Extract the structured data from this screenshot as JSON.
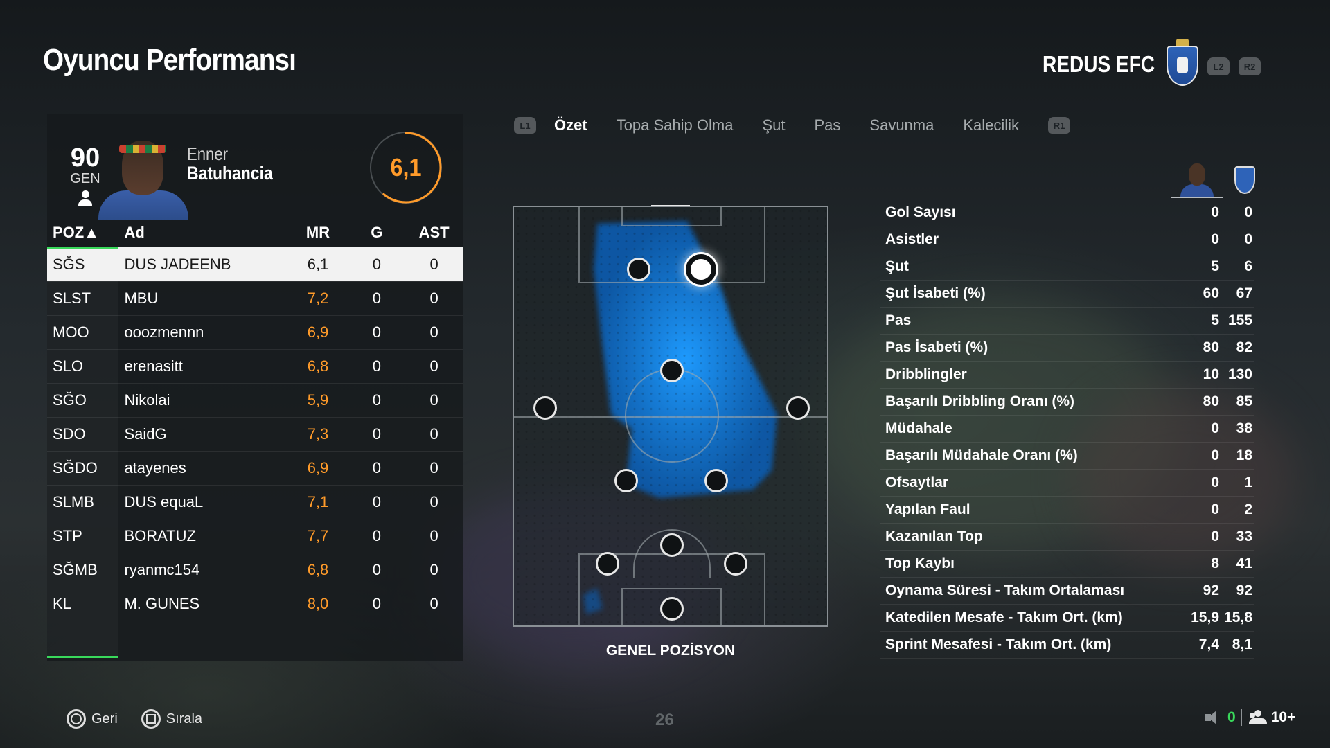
{
  "header": {
    "title": "Oyuncu Performansı",
    "club_name": "REDUS EFC",
    "l2_label": "L2",
    "r2_label": "R2"
  },
  "player": {
    "overall": "90",
    "overall_label": "GEN",
    "first_name": "Enner",
    "last_name": "Batuhancia",
    "match_rating": "6,1",
    "rating_fraction": 0.61
  },
  "table": {
    "headers": {
      "pos": "POZ▲",
      "name": "Ad",
      "mr": "MR",
      "g": "G",
      "ast": "AST"
    },
    "rows": [
      {
        "pos": "SĞS",
        "name": "DUS JADEENB",
        "mr": "6,1",
        "g": "0",
        "ast": "0",
        "selected": true
      },
      {
        "pos": "SLST",
        "name": "MBU",
        "mr": "7,2",
        "g": "0",
        "ast": "0"
      },
      {
        "pos": "MOO",
        "name": "ooozmennn",
        "mr": "6,9",
        "g": "0",
        "ast": "0"
      },
      {
        "pos": "SLO",
        "name": "erenasitt",
        "mr": "6,8",
        "g": "0",
        "ast": "0"
      },
      {
        "pos": "SĞO",
        "name": "Nikolai",
        "mr": "5,9",
        "g": "0",
        "ast": "0"
      },
      {
        "pos": "SDO",
        "name": "SaidG",
        "mr": "7,3",
        "g": "0",
        "ast": "0"
      },
      {
        "pos": "SĞDO",
        "name": "atayenes",
        "mr": "6,9",
        "g": "0",
        "ast": "0"
      },
      {
        "pos": "SLMB",
        "name": "DUS equaL",
        "mr": "7,1",
        "g": "0",
        "ast": "0"
      },
      {
        "pos": "STP",
        "name": "BORATUZ",
        "mr": "7,7",
        "g": "0",
        "ast": "0"
      },
      {
        "pos": "SĞMB",
        "name": "ryanmc154",
        "mr": "6,8",
        "g": "0",
        "ast": "0"
      },
      {
        "pos": "KL",
        "name": "M. GUNES",
        "mr": "8,0",
        "g": "0",
        "ast": "0"
      }
    ]
  },
  "tabs": {
    "l1": "L1",
    "r1": "R1",
    "items": [
      "Özet",
      "Topa Sahip Olma",
      "Şut",
      "Pas",
      "Savunma",
      "Kalecilik"
    ],
    "active": 0
  },
  "pitch": {
    "label": "GENEL POZİSYON"
  },
  "stats": [
    {
      "label": "Gol Sayısı",
      "player": "0",
      "team": "0"
    },
    {
      "label": "Asistler",
      "player": "0",
      "team": "0"
    },
    {
      "label": "Şut",
      "player": "5",
      "team": "6"
    },
    {
      "label": "Şut İsabeti (%)",
      "player": "60",
      "team": "67"
    },
    {
      "label": "Pas",
      "player": "5",
      "team": "155"
    },
    {
      "label": "Pas İsabeti (%)",
      "player": "80",
      "team": "82"
    },
    {
      "label": "Dribblingler",
      "player": "10",
      "team": "130"
    },
    {
      "label": "Başarılı Dribbling Oranı (%)",
      "player": "80",
      "team": "85"
    },
    {
      "label": "Müdahale",
      "player": "0",
      "team": "38"
    },
    {
      "label": "Başarılı Müdahale Oranı (%)",
      "player": "0",
      "team": "18"
    },
    {
      "label": "Ofsaytlar",
      "player": "0",
      "team": "1"
    },
    {
      "label": "Yapılan Faul",
      "player": "0",
      "team": "2"
    },
    {
      "label": "Kazanılan Top",
      "player": "0",
      "team": "33"
    },
    {
      "label": "Top Kaybı",
      "player": "8",
      "team": "41"
    },
    {
      "label": "Oynama Süresi - Takım Ortalaması",
      "player": "92",
      "team": "92"
    },
    {
      "label": "Katedilen Mesafe - Takım Ort. (km)",
      "player": "15,9",
      "team": "15,8"
    },
    {
      "label": "Sprint Mesafesi - Takım Ort. (km)",
      "player": "7,4",
      "team": "8,1"
    }
  ],
  "footer": {
    "back_label": "Geri",
    "sort_label": "Sırala",
    "page_number": "26",
    "green_count": "0",
    "players_count": "10+"
  },
  "colors": {
    "accent_green": "#39d95b",
    "rating_orange": "#ff9b2a",
    "heatmap_blue": "#1e9bff"
  }
}
